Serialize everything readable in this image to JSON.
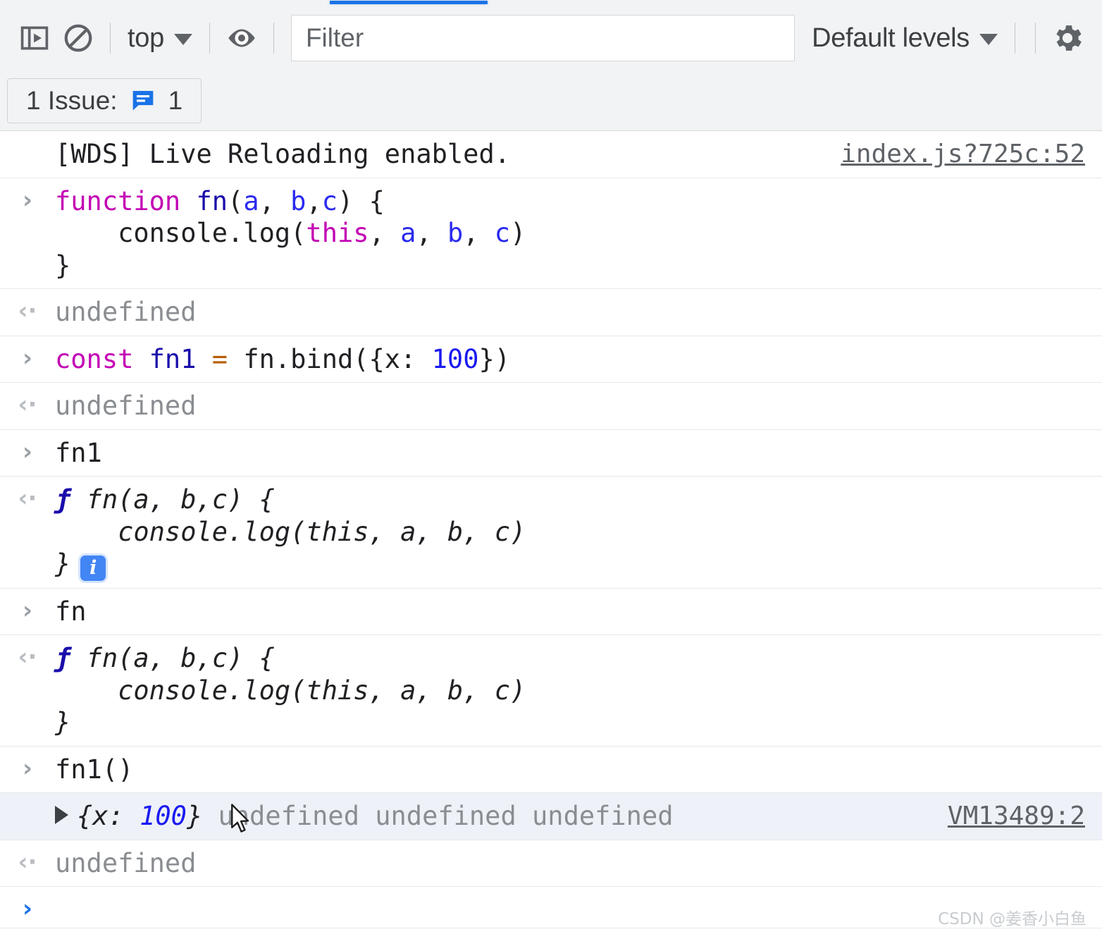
{
  "tabstrip": {
    "active_tab_indicator_color": "#1a73e8"
  },
  "toolbar": {
    "sidebar_toggle_icon": "sidebar-panel-icon",
    "clear_console_icon": "clear-console-icon",
    "context_selector": {
      "label": "top",
      "caret_icon": "chevron-down-icon"
    },
    "live_expression_icon": "eye-icon",
    "filter": {
      "placeholder": "Filter",
      "value": ""
    },
    "levels_selector": {
      "label": "Default levels",
      "caret_icon": "chevron-down-icon"
    },
    "settings_icon": "gear-icon"
  },
  "issues_bar": {
    "prefix": "1 Issue:",
    "issue_icon": "issue-speech-bubble-icon",
    "count": "1",
    "icon_color": "#1a73e8"
  },
  "console": {
    "rows": [
      {
        "kind": "log",
        "gutter": "none",
        "source": "index.js?725c:52",
        "tokens": [
          {
            "t": "[WDS] Live Reloading enabled.",
            "c": "plain"
          }
        ]
      },
      {
        "kind": "input",
        "gutter": "input-arrow",
        "lines": [
          [
            {
              "t": "function ",
              "c": "kw"
            },
            {
              "t": "fn",
              "c": "fname"
            },
            {
              "t": "(",
              "c": "plain"
            },
            {
              "t": "a",
              "c": "param"
            },
            {
              "t": ", ",
              "c": "plain"
            },
            {
              "t": "b",
              "c": "param"
            },
            {
              "t": ",",
              "c": "plain"
            },
            {
              "t": "c",
              "c": "param"
            },
            {
              "t": ") {",
              "c": "plain"
            }
          ],
          [
            {
              "t": "    console.log(",
              "c": "plain"
            },
            {
              "t": "this",
              "c": "kw"
            },
            {
              "t": ", ",
              "c": "plain"
            },
            {
              "t": "a",
              "c": "param"
            },
            {
              "t": ", ",
              "c": "plain"
            },
            {
              "t": "b",
              "c": "param"
            },
            {
              "t": ", ",
              "c": "plain"
            },
            {
              "t": "c",
              "c": "param"
            },
            {
              "t": ")",
              "c": "plain"
            }
          ],
          [
            {
              "t": "}",
              "c": "plain"
            }
          ]
        ]
      },
      {
        "kind": "output",
        "gutter": "output-arrow",
        "lines": [
          [
            {
              "t": "undefined",
              "c": "muted"
            }
          ]
        ]
      },
      {
        "kind": "input",
        "gutter": "input-arrow",
        "lines": [
          [
            {
              "t": "const ",
              "c": "kw"
            },
            {
              "t": "fn1",
              "c": "fname"
            },
            {
              "t": " ",
              "c": "plain"
            },
            {
              "t": "=",
              "c": "op"
            },
            {
              "t": " fn.bind({x: ",
              "c": "plain"
            },
            {
              "t": "100",
              "c": "num"
            },
            {
              "t": "})",
              "c": "plain"
            }
          ]
        ]
      },
      {
        "kind": "output",
        "gutter": "output-arrow",
        "lines": [
          [
            {
              "t": "undefined",
              "c": "muted"
            }
          ]
        ]
      },
      {
        "kind": "input",
        "gutter": "input-arrow",
        "lines": [
          [
            {
              "t": "fn1",
              "c": "plain"
            }
          ]
        ]
      },
      {
        "kind": "output-fn",
        "gutter": "output-arrow",
        "italic": true,
        "f_glyph": "ƒ",
        "info_badge": "i",
        "lines": [
          [
            {
              "t": "fn(a, b,c) {",
              "c": "plain"
            }
          ],
          [
            {
              "t": "    console.log(this, a, b, c)",
              "c": "plain"
            }
          ],
          [
            {
              "t": "}",
              "c": "plain"
            }
          ]
        ]
      },
      {
        "kind": "input",
        "gutter": "input-arrow",
        "lines": [
          [
            {
              "t": "fn",
              "c": "plain"
            }
          ]
        ]
      },
      {
        "kind": "output-fn",
        "gutter": "output-arrow",
        "italic": true,
        "f_glyph": "ƒ",
        "info_badge": "",
        "lines": [
          [
            {
              "t": "fn(a, b,c) {",
              "c": "plain"
            }
          ],
          [
            {
              "t": "    console.log(this, a, b, c)",
              "c": "plain"
            }
          ],
          [
            {
              "t": "}",
              "c": "plain"
            }
          ]
        ]
      },
      {
        "kind": "input",
        "gutter": "input-arrow",
        "lines": [
          [
            {
              "t": "fn1()",
              "c": "plain"
            }
          ]
        ]
      },
      {
        "kind": "log-selected",
        "gutter": "none",
        "selected": true,
        "expander": "disclosure-triangle",
        "source": "VM13489:2",
        "lines": [
          [
            {
              "t": "{x: ",
              "c": "plain",
              "i": true
            },
            {
              "t": "100",
              "c": "num",
              "i": true
            },
            {
              "t": "}",
              "c": "plain",
              "i": true
            },
            {
              "t": " undefined undefined undefined",
              "c": "muted"
            }
          ]
        ]
      },
      {
        "kind": "output",
        "gutter": "output-arrow",
        "lines": [
          [
            {
              "t": "undefined",
              "c": "muted"
            }
          ]
        ]
      },
      {
        "kind": "prompt",
        "gutter": "prompt-arrow",
        "lines": [
          [
            {
              "t": "",
              "c": "plain"
            }
          ]
        ]
      }
    ]
  },
  "watermark": {
    "text": "CSDN @姜香小白鱼"
  }
}
